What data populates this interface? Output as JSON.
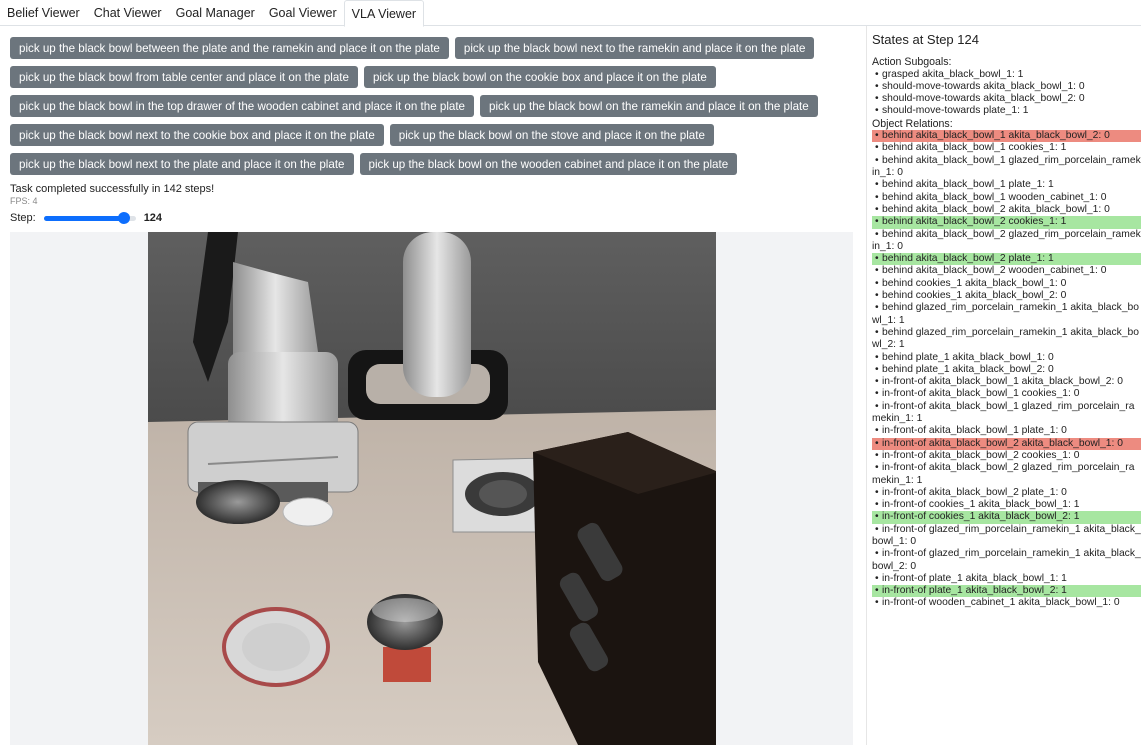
{
  "tabs": [
    "Belief Viewer",
    "Chat Viewer",
    "Goal Manager",
    "Goal Viewer",
    "VLA Viewer"
  ],
  "active_tab": "VLA Viewer",
  "tasks": [
    [
      "pick up the black bowl between the plate and the ramekin and place it on the plate",
      "pick up the black bowl next to the ramekin and place it on the plate"
    ],
    [
      "pick up the black bowl from table center and place it on the plate",
      "pick up the black bowl on the cookie box and place it on the plate"
    ],
    [
      "pick up the black bowl in the top drawer of the wooden cabinet and place it on the plate",
      "pick up the black bowl on the ramekin and place it on the plate"
    ],
    [
      "pick up the black bowl next to the cookie box and place it on the plate",
      "pick up the black bowl on the stove and place it on the plate"
    ],
    [
      "pick up the black bowl next to the plate and place it on the plate",
      "pick up the black bowl on the wooden cabinet and place it on the plate"
    ]
  ],
  "status": "Task completed successfully in 142 steps!",
  "fps": "FPS: 4",
  "step": {
    "label": "Step:",
    "value": "124",
    "fraction": 0.873
  },
  "panel": {
    "title": "States at Step 124",
    "subgoals_title": "Action Subgoals:",
    "subgoals": [
      "grasped akita_black_bowl_1: 1",
      "should-move-towards akita_black_bowl_1: 0",
      "should-move-towards akita_black_bowl_2: 0",
      "should-move-towards plate_1: 1"
    ],
    "relations_title": "Object Relations:",
    "relations": [
      {
        "text": "behind akita_black_bowl_1 akita_black_bowl_2: 0",
        "hl": "red"
      },
      {
        "text": "behind akita_black_bowl_1 cookies_1: 1",
        "hl": ""
      },
      {
        "text": "behind akita_black_bowl_1 glazed_rim_porcelain_ramekin_1: 0",
        "hl": "",
        "wrap": true
      },
      {
        "text": "behind akita_black_bowl_1 plate_1: 1",
        "hl": ""
      },
      {
        "text": "behind akita_black_bowl_1 wooden_cabinet_1: 0",
        "hl": ""
      },
      {
        "text": "behind akita_black_bowl_2 akita_black_bowl_1: 0",
        "hl": ""
      },
      {
        "text": "behind akita_black_bowl_2 cookies_1: 1",
        "hl": "green"
      },
      {
        "text": "behind akita_black_bowl_2 glazed_rim_porcelain_ramekin_1: 0",
        "hl": "",
        "wrap": true
      },
      {
        "text": "behind akita_black_bowl_2 plate_1: 1",
        "hl": "green"
      },
      {
        "text": "behind akita_black_bowl_2 wooden_cabinet_1: 0",
        "hl": ""
      },
      {
        "text": "behind cookies_1 akita_black_bowl_1: 0",
        "hl": ""
      },
      {
        "text": "behind cookies_1 akita_black_bowl_2: 0",
        "hl": ""
      },
      {
        "text": "behind glazed_rim_porcelain_ramekin_1 akita_black_bowl_1: 1",
        "hl": "",
        "wrap": true
      },
      {
        "text": "behind glazed_rim_porcelain_ramekin_1 akita_black_bowl_2: 1",
        "hl": "",
        "wrap": true
      },
      {
        "text": "behind plate_1 akita_black_bowl_1: 0",
        "hl": ""
      },
      {
        "text": "behind plate_1 akita_black_bowl_2: 0",
        "hl": ""
      },
      {
        "text": "in-front-of akita_black_bowl_1 akita_black_bowl_2: 0",
        "hl": "",
        "wrap": true
      },
      {
        "text": "in-front-of akita_black_bowl_1 cookies_1: 0",
        "hl": ""
      },
      {
        "text": "in-front-of akita_black_bowl_1 glazed_rim_porcelain_ramekin_1: 1",
        "hl": "",
        "wrap": true
      },
      {
        "text": "in-front-of akita_black_bowl_1 plate_1: 0",
        "hl": ""
      },
      {
        "text": "in-front-of akita_black_bowl_2 akita_black_bowl_1: 0",
        "hl": "red",
        "wrap": true
      },
      {
        "text": "in-front-of akita_black_bowl_2 cookies_1: 0",
        "hl": ""
      },
      {
        "text": "in-front-of akita_black_bowl_2 glazed_rim_porcelain_ramekin_1: 1",
        "hl": "",
        "wrap": true
      },
      {
        "text": "in-front-of akita_black_bowl_2 plate_1: 0",
        "hl": ""
      },
      {
        "text": "in-front-of cookies_1 akita_black_bowl_1: 1",
        "hl": ""
      },
      {
        "text": "in-front-of cookies_1 akita_black_bowl_2: 1",
        "hl": "green"
      },
      {
        "text": "in-front-of glazed_rim_porcelain_ramekin_1 akita_black_bowl_1: 0",
        "hl": "",
        "wrap": true
      },
      {
        "text": "in-front-of glazed_rim_porcelain_ramekin_1 akita_black_bowl_2: 0",
        "hl": "",
        "wrap": true
      },
      {
        "text": "in-front-of plate_1 akita_black_bowl_1: 1",
        "hl": ""
      },
      {
        "text": "in-front-of plate_1 akita_black_bowl_2: 1",
        "hl": "green"
      },
      {
        "text": "in-front-of wooden_cabinet_1 akita_black_bowl_1: 0",
        "hl": "",
        "wrap": true
      }
    ]
  }
}
